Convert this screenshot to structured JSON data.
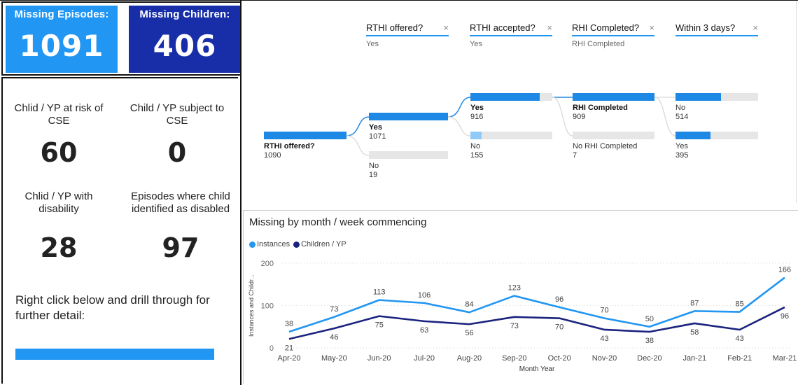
{
  "kpis": {
    "missing_episodes": {
      "label": "Missing Episodes:",
      "value": "1091"
    },
    "missing_children": {
      "label": "Missing Children:",
      "value": "406"
    }
  },
  "metrics": [
    {
      "label": "Chlid / YP at risk of CSE",
      "value": "60"
    },
    {
      "label": "Child / YP subject to CSE",
      "value": "0"
    },
    {
      "label": "Chlid / YP with disability",
      "value": "28"
    },
    {
      "label": "Episodes where child identified as disabled",
      "value": "97"
    }
  ],
  "drill": {
    "text": "Right click below and drill through for further detail:"
  },
  "colors": {
    "primary": "#2196f3",
    "dark": "#172ea8",
    "tree": "#1e88e5",
    "light": "#90caf9"
  },
  "tree": {
    "slicers": [
      {
        "label": "RTHI offered?",
        "value": "Yes"
      },
      {
        "label": "RTHI accepted?",
        "value": "Yes"
      },
      {
        "label": "RHI Completed?",
        "value": "RHI Completed"
      },
      {
        "label": "Within 3 days?",
        "value": ""
      }
    ],
    "root": {
      "label": "RTHI offered?",
      "value": "1090"
    },
    "level1": [
      {
        "label": "Yes",
        "value": "1071",
        "fraction": 1.0,
        "bold": true
      },
      {
        "label": "No",
        "value": "19",
        "fraction": 0.0,
        "bold": false
      }
    ],
    "level2": [
      {
        "label": "Yes",
        "value": "916",
        "fraction": 0.85,
        "bold": true
      },
      {
        "label": "No",
        "value": "155",
        "fraction": 0.14,
        "bold": false
      }
    ],
    "level3": [
      {
        "label": "RHI Completed",
        "value": "909",
        "fraction": 1.0,
        "bold": true
      },
      {
        "label": "No RHI Completed",
        "value": "7",
        "fraction": 0.0,
        "bold": false
      }
    ],
    "level4": [
      {
        "label": "No",
        "value": "514",
        "fraction": 0.55,
        "bold": false
      },
      {
        "label": "Yes",
        "value": "395",
        "fraction": 0.42,
        "bold": false
      }
    ]
  },
  "chart_data": {
    "type": "line",
    "title": "Missing by month / week commencing",
    "xlabel": "Month Year",
    "ylabel": "Instances and Childr...",
    "ylim": [
      0,
      200
    ],
    "yticks": [
      "0",
      "100",
      "200"
    ],
    "categories": [
      "Apr-20",
      "May-20",
      "Jun-20",
      "Jul-20",
      "Aug-20",
      "Sep-20",
      "Oct-20",
      "Nov-20",
      "Dec-20",
      "Jan-21",
      "Feb-21",
      "Mar-21"
    ],
    "series": [
      {
        "name": "Instances",
        "color": "#2196f3",
        "values": [
          38,
          73,
          113,
          106,
          84,
          123,
          96,
          70,
          50,
          87,
          85,
          166
        ],
        "labels": [
          "38",
          "73",
          "113",
          "106",
          "84",
          "123",
          "96",
          "70",
          "50",
          "87",
          "85",
          "166"
        ]
      },
      {
        "name": "Children / YP",
        "color": "#1a237e",
        "values": [
          21,
          46,
          75,
          63,
          56,
          73,
          70,
          43,
          38,
          58,
          43,
          96
        ],
        "labels": [
          "21",
          "46",
          "75",
          "63",
          "56",
          "73",
          "70",
          "43",
          "38",
          "58",
          "43",
          "96"
        ]
      }
    ],
    "grid": true,
    "legend": "top-left"
  }
}
